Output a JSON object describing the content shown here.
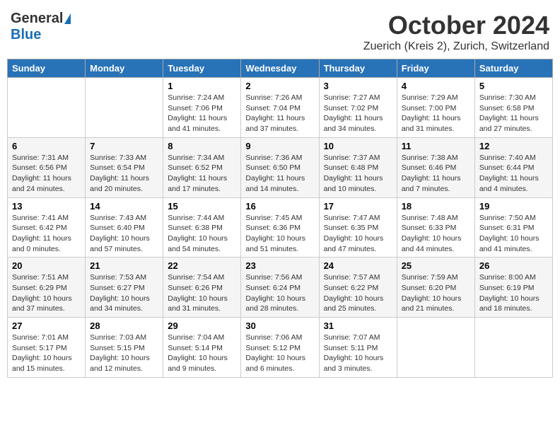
{
  "logo": {
    "general": "General",
    "blue": "Blue"
  },
  "title": "October 2024",
  "location": "Zuerich (Kreis 2), Zurich, Switzerland",
  "days_of_week": [
    "Sunday",
    "Monday",
    "Tuesday",
    "Wednesday",
    "Thursday",
    "Friday",
    "Saturday"
  ],
  "weeks": [
    [
      {
        "day": "",
        "info": ""
      },
      {
        "day": "",
        "info": ""
      },
      {
        "day": "1",
        "info": "Sunrise: 7:24 AM\nSunset: 7:06 PM\nDaylight: 11 hours and 41 minutes."
      },
      {
        "day": "2",
        "info": "Sunrise: 7:26 AM\nSunset: 7:04 PM\nDaylight: 11 hours and 37 minutes."
      },
      {
        "day": "3",
        "info": "Sunrise: 7:27 AM\nSunset: 7:02 PM\nDaylight: 11 hours and 34 minutes."
      },
      {
        "day": "4",
        "info": "Sunrise: 7:29 AM\nSunset: 7:00 PM\nDaylight: 11 hours and 31 minutes."
      },
      {
        "day": "5",
        "info": "Sunrise: 7:30 AM\nSunset: 6:58 PM\nDaylight: 11 hours and 27 minutes."
      }
    ],
    [
      {
        "day": "6",
        "info": "Sunrise: 7:31 AM\nSunset: 6:56 PM\nDaylight: 11 hours and 24 minutes."
      },
      {
        "day": "7",
        "info": "Sunrise: 7:33 AM\nSunset: 6:54 PM\nDaylight: 11 hours and 20 minutes."
      },
      {
        "day": "8",
        "info": "Sunrise: 7:34 AM\nSunset: 6:52 PM\nDaylight: 11 hours and 17 minutes."
      },
      {
        "day": "9",
        "info": "Sunrise: 7:36 AM\nSunset: 6:50 PM\nDaylight: 11 hours and 14 minutes."
      },
      {
        "day": "10",
        "info": "Sunrise: 7:37 AM\nSunset: 6:48 PM\nDaylight: 11 hours and 10 minutes."
      },
      {
        "day": "11",
        "info": "Sunrise: 7:38 AM\nSunset: 6:46 PM\nDaylight: 11 hours and 7 minutes."
      },
      {
        "day": "12",
        "info": "Sunrise: 7:40 AM\nSunset: 6:44 PM\nDaylight: 11 hours and 4 minutes."
      }
    ],
    [
      {
        "day": "13",
        "info": "Sunrise: 7:41 AM\nSunset: 6:42 PM\nDaylight: 11 hours and 0 minutes."
      },
      {
        "day": "14",
        "info": "Sunrise: 7:43 AM\nSunset: 6:40 PM\nDaylight: 10 hours and 57 minutes."
      },
      {
        "day": "15",
        "info": "Sunrise: 7:44 AM\nSunset: 6:38 PM\nDaylight: 10 hours and 54 minutes."
      },
      {
        "day": "16",
        "info": "Sunrise: 7:45 AM\nSunset: 6:36 PM\nDaylight: 10 hours and 51 minutes."
      },
      {
        "day": "17",
        "info": "Sunrise: 7:47 AM\nSunset: 6:35 PM\nDaylight: 10 hours and 47 minutes."
      },
      {
        "day": "18",
        "info": "Sunrise: 7:48 AM\nSunset: 6:33 PM\nDaylight: 10 hours and 44 minutes."
      },
      {
        "day": "19",
        "info": "Sunrise: 7:50 AM\nSunset: 6:31 PM\nDaylight: 10 hours and 41 minutes."
      }
    ],
    [
      {
        "day": "20",
        "info": "Sunrise: 7:51 AM\nSunset: 6:29 PM\nDaylight: 10 hours and 37 minutes."
      },
      {
        "day": "21",
        "info": "Sunrise: 7:53 AM\nSunset: 6:27 PM\nDaylight: 10 hours and 34 minutes."
      },
      {
        "day": "22",
        "info": "Sunrise: 7:54 AM\nSunset: 6:26 PM\nDaylight: 10 hours and 31 minutes."
      },
      {
        "day": "23",
        "info": "Sunrise: 7:56 AM\nSunset: 6:24 PM\nDaylight: 10 hours and 28 minutes."
      },
      {
        "day": "24",
        "info": "Sunrise: 7:57 AM\nSunset: 6:22 PM\nDaylight: 10 hours and 25 minutes."
      },
      {
        "day": "25",
        "info": "Sunrise: 7:59 AM\nSunset: 6:20 PM\nDaylight: 10 hours and 21 minutes."
      },
      {
        "day": "26",
        "info": "Sunrise: 8:00 AM\nSunset: 6:19 PM\nDaylight: 10 hours and 18 minutes."
      }
    ],
    [
      {
        "day": "27",
        "info": "Sunrise: 7:01 AM\nSunset: 5:17 PM\nDaylight: 10 hours and 15 minutes."
      },
      {
        "day": "28",
        "info": "Sunrise: 7:03 AM\nSunset: 5:15 PM\nDaylight: 10 hours and 12 minutes."
      },
      {
        "day": "29",
        "info": "Sunrise: 7:04 AM\nSunset: 5:14 PM\nDaylight: 10 hours and 9 minutes."
      },
      {
        "day": "30",
        "info": "Sunrise: 7:06 AM\nSunset: 5:12 PM\nDaylight: 10 hours and 6 minutes."
      },
      {
        "day": "31",
        "info": "Sunrise: 7:07 AM\nSunset: 5:11 PM\nDaylight: 10 hours and 3 minutes."
      },
      {
        "day": "",
        "info": ""
      },
      {
        "day": "",
        "info": ""
      }
    ]
  ]
}
